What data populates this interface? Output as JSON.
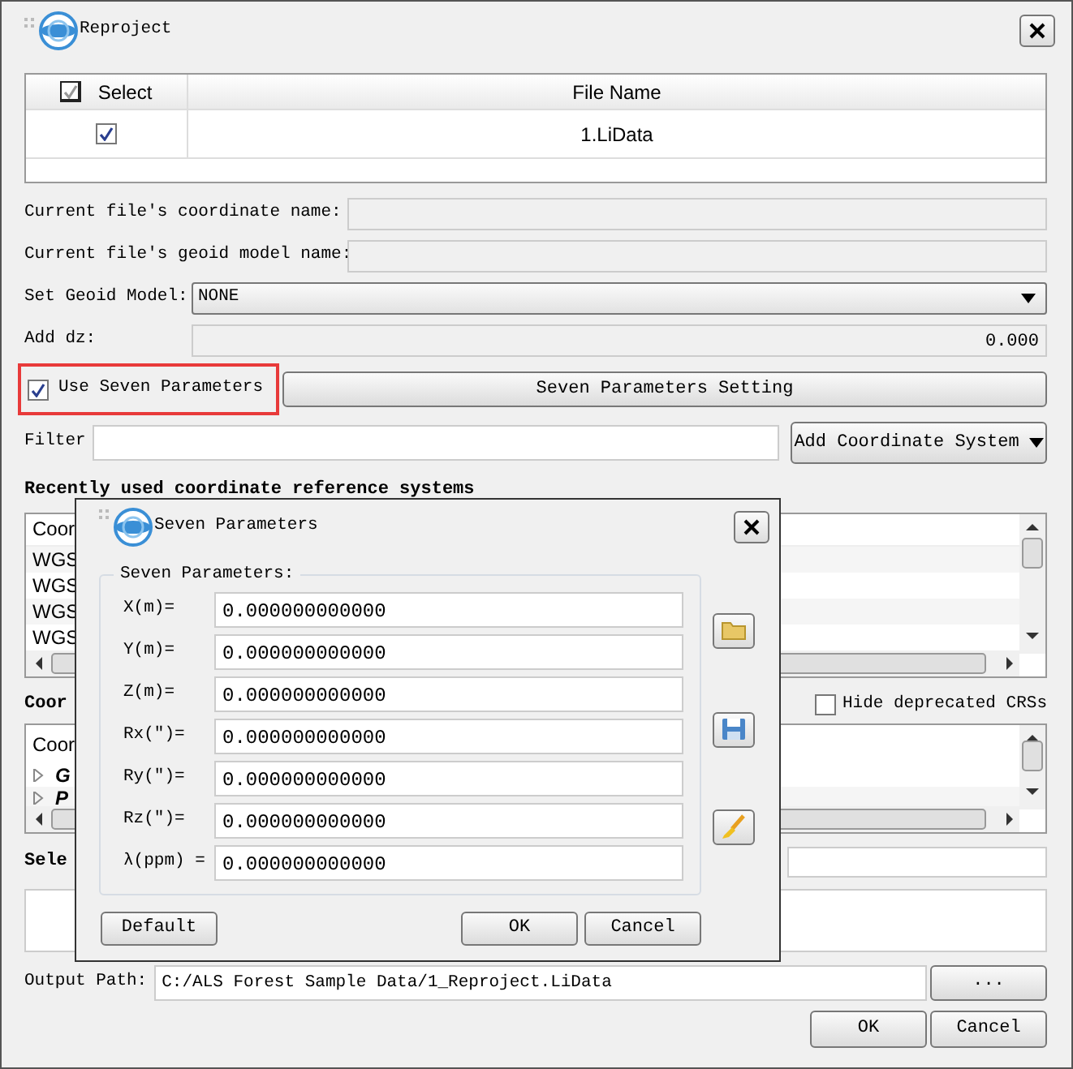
{
  "window": {
    "title": "Reproject"
  },
  "files": {
    "columns": [
      "Select",
      "File Name"
    ],
    "header_checked": true,
    "rows": [
      {
        "checked": true,
        "name": "1.LiData"
      }
    ]
  },
  "coordinate_name": {
    "label": "Current file's coordinate name:"
  },
  "geoid_model_name": {
    "label": "Current file's geoid model name:"
  },
  "geoid_select": {
    "label": "Set Geoid Model:",
    "value": "NONE"
  },
  "add_dz": {
    "label": "Add dz:",
    "value": "0.000"
  },
  "use_seven": {
    "label": "Use Seven Parameters",
    "checked": true,
    "highlighted": true
  },
  "seven_setting_button": "Seven Parameters Setting",
  "filter": {
    "label": "Filter"
  },
  "add_crs_button": "Add Coordinate System",
  "recent": {
    "heading": "Recently used coordinate reference systems",
    "column": "Coor",
    "rows": [
      "WGS",
      "WGS",
      "WGS",
      "WGS"
    ]
  },
  "crs": {
    "heading": "Coor",
    "hide_deprecated": {
      "label": "Hide deprecated CRSs",
      "checked": false
    },
    "column": "Coor",
    "items": [
      {
        "label": "G",
        "expanded": false
      },
      {
        "label": "P",
        "expanded": false
      }
    ]
  },
  "selected": {
    "heading": "Sele"
  },
  "output": {
    "label": "Output Path:",
    "value": "C:/ALS Forest Sample Data/1_Reproject.LiData",
    "browse": "..."
  },
  "buttons": [
    "OK",
    "Cancel"
  ],
  "dialog": {
    "title": "Seven Parameters",
    "group": "Seven Parameters:",
    "params": [
      {
        "label": "X(m)=",
        "value": "0.000000000000"
      },
      {
        "label": "Y(m)=",
        "value": "0.000000000000"
      },
      {
        "label": "Z(m)=",
        "value": "0.000000000000"
      },
      {
        "label": "Rx(\")=",
        "value": "0.000000000000"
      },
      {
        "label": "Ry(\")=",
        "value": "0.000000000000"
      },
      {
        "label": "Rz(\")=",
        "value": "0.000000000000"
      },
      {
        "label": "λ(ppm) =",
        "value": "0.000000000000"
      }
    ],
    "default_button": "Default",
    "buttons": [
      "OK",
      "Cancel"
    ]
  }
}
